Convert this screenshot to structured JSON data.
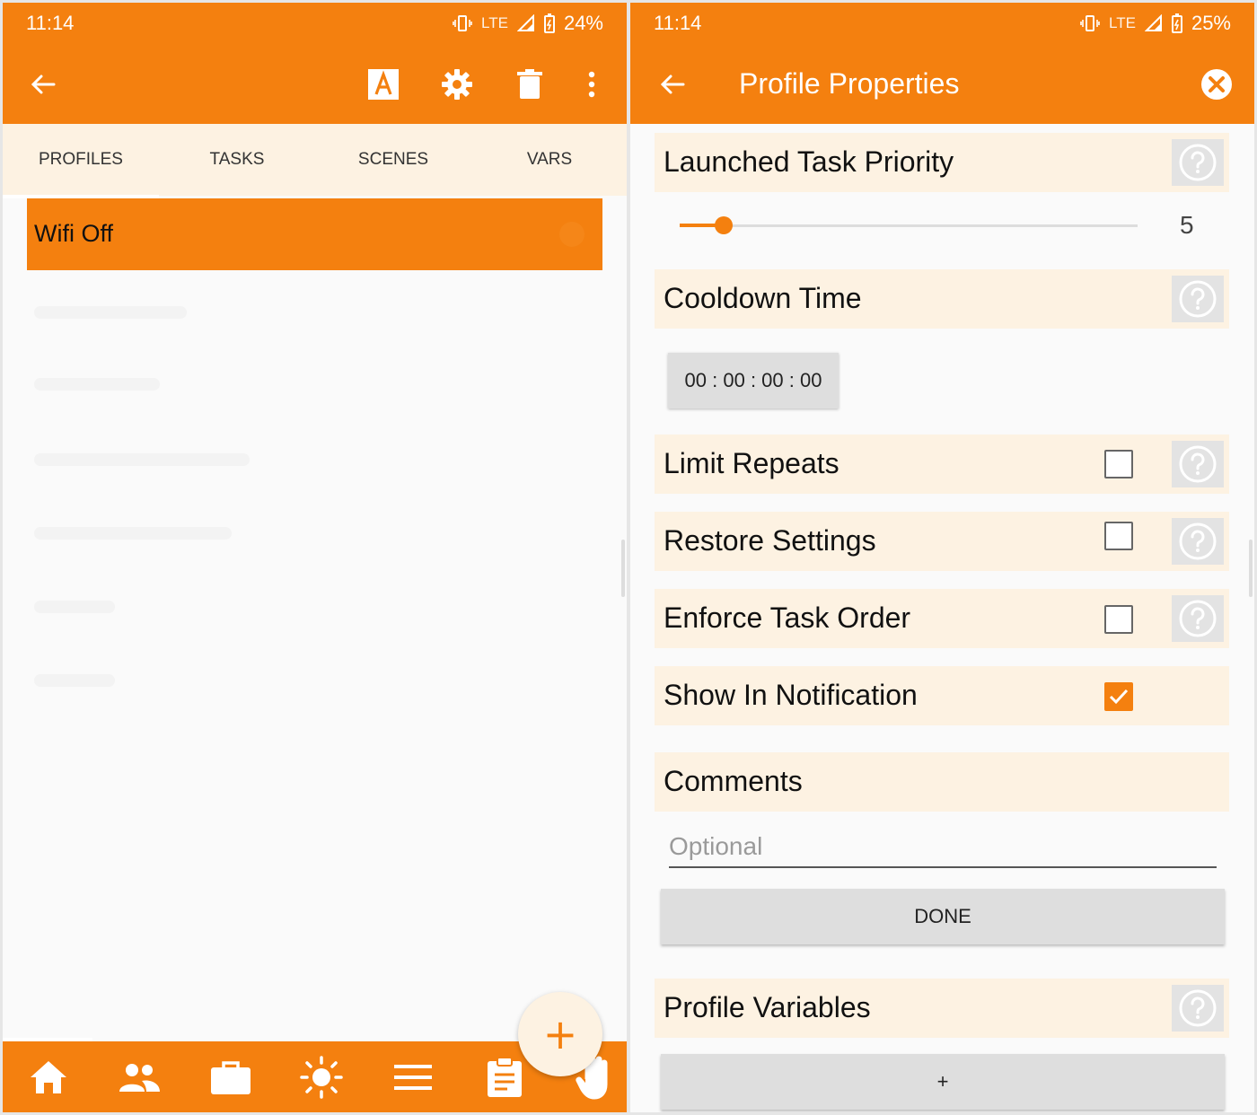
{
  "left": {
    "status": {
      "time": "11:14",
      "network": "LTE",
      "battery": "24%"
    },
    "toolbar": {
      "back_icon": "arrow-left-icon",
      "icons": [
        "text-a-icon",
        "gear-icon",
        "trash-icon",
        "more-vert-icon"
      ]
    },
    "tabs": [
      "PROFILES",
      "TASKS",
      "SCENES",
      "VARS"
    ],
    "active_tab": "PROFILES",
    "profiles": [
      {
        "label": "Wifi Off"
      }
    ],
    "fab_label": "+",
    "bottom_nav": [
      "home-icon",
      "people-icon",
      "briefcase-icon",
      "sun-icon",
      "menu-lines-icon",
      "clipboard-icon"
    ],
    "colors": {
      "accent": "#f4800f",
      "tab_bg": "#fdf2e2"
    }
  },
  "right": {
    "status": {
      "time": "11:14",
      "network": "LTE",
      "battery": "25%"
    },
    "title": "Profile Properties",
    "launched_task_priority": {
      "label": "Launched Task Priority",
      "value": "5"
    },
    "cooldown_time": {
      "label": "Cooldown Time",
      "value": "00 : 00 : 00 : 00"
    },
    "limit_repeats": {
      "label": "Limit Repeats",
      "checked": false
    },
    "restore_settings": {
      "label": "Restore Settings",
      "checked": false
    },
    "enforce_task_order": {
      "label": "Enforce Task Order",
      "checked": false
    },
    "show_in_notification": {
      "label": "Show In Notification",
      "checked": true
    },
    "comments": {
      "label": "Comments",
      "placeholder": "Optional",
      "value": ""
    },
    "done_label": "DONE",
    "profile_variables": {
      "label": "Profile Variables",
      "add_label": "+"
    }
  }
}
